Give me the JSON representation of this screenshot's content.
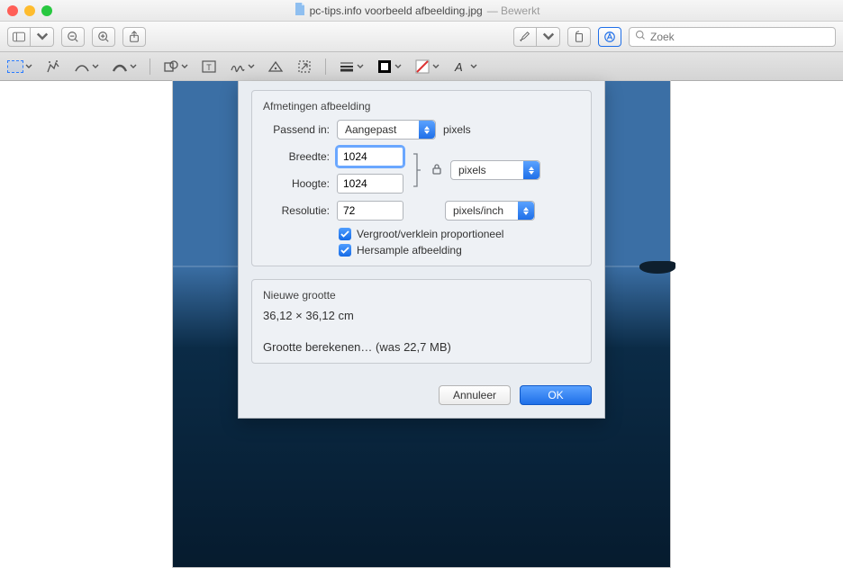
{
  "window": {
    "filename": "pc-tips.info voorbeeld afbeelding.jpg",
    "status": "— Bewerkt"
  },
  "toolbar": {
    "search_placeholder": "Zoek"
  },
  "dialog": {
    "section_title": "Afmetingen afbeelding",
    "fit_label": "Passend in:",
    "fit_value": "Aangepast",
    "fit_unit": "pixels",
    "width_label": "Breedte:",
    "width_value": "1024",
    "height_label": "Hoogte:",
    "height_value": "1024",
    "dim_unit": "pixels",
    "res_label": "Resolutie:",
    "res_value": "72",
    "res_unit": "pixels/inch",
    "chk_scale": "Vergroot/verklein proportioneel",
    "chk_resample": "Hersample afbeelding",
    "result_title": "Nieuwe grootte",
    "result_dims": "36,12 × 36,12 cm",
    "calc": "Grootte berekenen… (was 22,7 MB)",
    "cancel": "Annuleer",
    "ok": "OK"
  }
}
